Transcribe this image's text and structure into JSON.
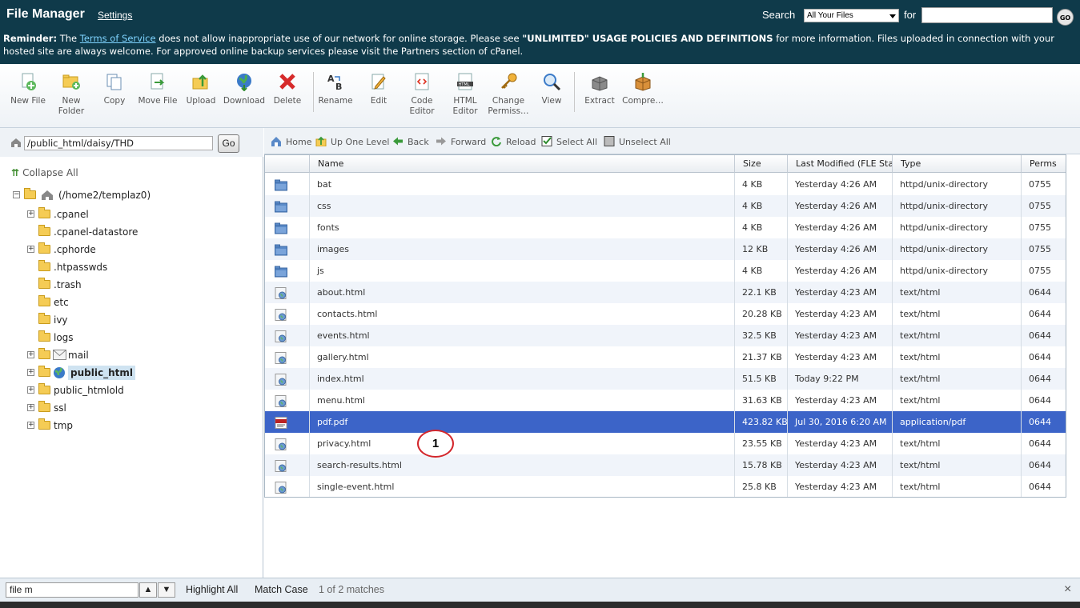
{
  "header": {
    "title": "File Manager",
    "settings_label": "Settings",
    "search_label": "Search",
    "search_scope": "All Your Files",
    "for_label": "for",
    "search_value": "",
    "go_label": "GO",
    "reminder": {
      "lead": "Reminder:",
      "t1": " The ",
      "tos": "Terms of Service",
      "t2": " does not allow inappropriate use of our network for online storage. Please see ",
      "policy": "\"UNLIMITED\" USAGE POLICIES AND DEFINITIONS",
      "t3": " for more information. Files uploaded in connection with your hosted site are always welcome. For approved online backup services please visit the Partners section of cPanel."
    }
  },
  "toolbar": {
    "new_file": "New File",
    "new_folder": "New Folder",
    "copy": "Copy",
    "move_file": "Move File",
    "upload": "Upload",
    "download": "Download",
    "delete": "Delete",
    "rename": "Rename",
    "edit": "Edit",
    "code_editor": "Code Editor",
    "html_editor": "HTML Editor",
    "change_permissions": "Change Permiss…",
    "view": "View",
    "extract": "Extract",
    "compress": "Compre…"
  },
  "left": {
    "path_value": "/public_html/daisy/THD",
    "go_label": "Go",
    "collapse_all": "Collapse All",
    "root": "(/home2/templaz0)",
    "tree": [
      ".cpanel",
      ".cpanel-datastore",
      ".cphorde",
      ".htpasswds",
      ".trash",
      "etc",
      "ivy",
      "logs",
      "mail",
      "public_html",
      "public_htmlold",
      "ssl",
      "tmp"
    ]
  },
  "nav": {
    "home": "Home",
    "up_one_level": "Up One Level",
    "back": "Back",
    "forward": "Forward",
    "reload": "Reload",
    "select_all": "Select All",
    "unselect_all": "Unselect All"
  },
  "table": {
    "headers": {
      "name": "Name",
      "size": "Size",
      "modified": "Last Modified (FLE Stand",
      "type": "Type",
      "perms": "Perms"
    },
    "rows": [
      {
        "name": "bat",
        "size": "4 KB",
        "modified": "Yesterday 4:26 AM",
        "type": "httpd/unix-directory",
        "perms": "0755",
        "kind": "folder-icon"
      },
      {
        "name": "css",
        "size": "4 KB",
        "modified": "Yesterday 4:26 AM",
        "type": "httpd/unix-directory",
        "perms": "0755",
        "kind": "folder-icon"
      },
      {
        "name": "fonts",
        "size": "4 KB",
        "modified": "Yesterday 4:26 AM",
        "type": "httpd/unix-directory",
        "perms": "0755",
        "kind": "folder-icon"
      },
      {
        "name": "images",
        "size": "12 KB",
        "modified": "Yesterday 4:26 AM",
        "type": "httpd/unix-directory",
        "perms": "0755",
        "kind": "folder-icon"
      },
      {
        "name": "js",
        "size": "4 KB",
        "modified": "Yesterday 4:26 AM",
        "type": "httpd/unix-directory",
        "perms": "0755",
        "kind": "folder-icon"
      },
      {
        "name": "about.html",
        "size": "22.1 KB",
        "modified": "Yesterday 4:23 AM",
        "type": "text/html",
        "perms": "0644",
        "kind": "html-file-icon"
      },
      {
        "name": "contacts.html",
        "size": "20.28 KB",
        "modified": "Yesterday 4:23 AM",
        "type": "text/html",
        "perms": "0644",
        "kind": "html-file-icon"
      },
      {
        "name": "events.html",
        "size": "32.5 KB",
        "modified": "Yesterday 4:23 AM",
        "type": "text/html",
        "perms": "0644",
        "kind": "html-file-icon"
      },
      {
        "name": "gallery.html",
        "size": "21.37 KB",
        "modified": "Yesterday 4:23 AM",
        "type": "text/html",
        "perms": "0644",
        "kind": "html-file-icon"
      },
      {
        "name": "index.html",
        "size": "51.5 KB",
        "modified": "Today 9:22 PM",
        "type": "text/html",
        "perms": "0644",
        "kind": "html-file-icon"
      },
      {
        "name": "menu.html",
        "size": "31.63 KB",
        "modified": "Yesterday 4:23 AM",
        "type": "text/html",
        "perms": "0644",
        "kind": "html-file-icon"
      },
      {
        "name": "pdf.pdf",
        "size": "423.82 KB",
        "modified": "Jul 30, 2016 6:20 AM",
        "type": "application/pdf",
        "perms": "0644",
        "kind": "pdf-file-icon",
        "selected": true
      },
      {
        "name": "privacy.html",
        "size": "23.55 KB",
        "modified": "Yesterday 4:23 AM",
        "type": "text/html",
        "perms": "0644",
        "kind": "html-file-icon"
      },
      {
        "name": "search-results.html",
        "size": "15.78 KB",
        "modified": "Yesterday 4:23 AM",
        "type": "text/html",
        "perms": "0644",
        "kind": "html-file-icon"
      },
      {
        "name": "single-event.html",
        "size": "25.8 KB",
        "modified": "Yesterday 4:23 AM",
        "type": "text/html",
        "perms": "0644",
        "kind": "html-file-icon"
      }
    ]
  },
  "findbar": {
    "query": "file m",
    "highlight_all": "Highlight All",
    "match_case": "Match Case",
    "status": "1 of 2 matches",
    "close": "×"
  },
  "marker": {
    "label": "1"
  },
  "colors": {
    "header_bg": "#0f3a4a",
    "selected_row": "#3c64c8",
    "alt_row": "#f0f4fa",
    "marker_red": "#d3262b"
  }
}
